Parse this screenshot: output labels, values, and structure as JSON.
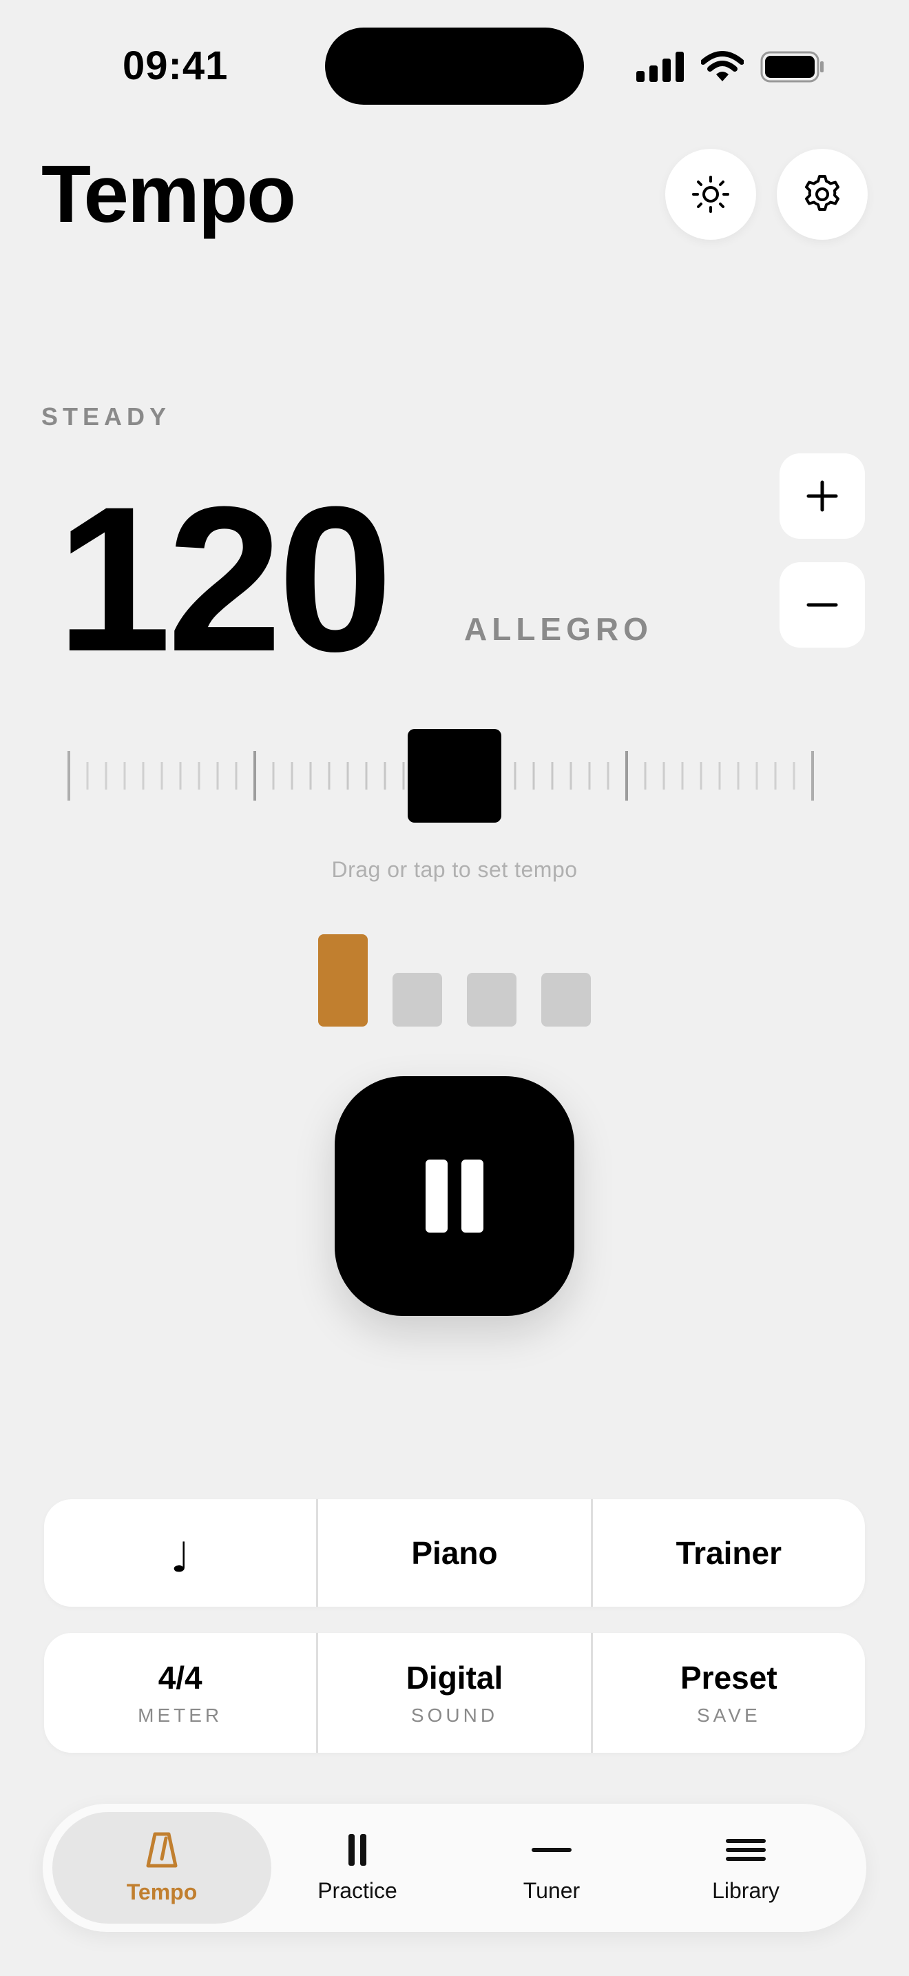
{
  "status": {
    "time": "09:41"
  },
  "header": {
    "title": "Tempo",
    "theme_icon": "sun-icon",
    "settings_icon": "gear-icon"
  },
  "tempo": {
    "mood": "STEADY",
    "bpm": "120",
    "marking": "ALLEGRO",
    "increase_icon": "plus-icon",
    "decrease_icon": "minus-icon",
    "hint": "Drag or tap to set tempo"
  },
  "beats": {
    "count": 4,
    "current": 1,
    "accent_color": "#c17f2f",
    "inactive_color": "#cccccc"
  },
  "transport": {
    "state": "playing",
    "icon": "pause-icon"
  },
  "options_row1": {
    "note_symbol": "♩",
    "sound_label": "Piano",
    "trainer_label": "Trainer"
  },
  "options_row2": [
    {
      "value": "4/4",
      "caption": "METER"
    },
    {
      "value": "Digital",
      "caption": "SOUND"
    },
    {
      "value": "Preset",
      "caption": "SAVE"
    }
  ],
  "tabs": [
    {
      "label": "Tempo",
      "icon": "metronome-icon",
      "active": true
    },
    {
      "label": "Practice",
      "icon": "pause-icon",
      "active": false
    },
    {
      "label": "Tuner",
      "icon": "minus-icon",
      "active": false
    },
    {
      "label": "Library",
      "icon": "menu-icon",
      "active": false
    }
  ],
  "colors": {
    "accent": "#c17f2f",
    "background": "#f0f0f0"
  }
}
